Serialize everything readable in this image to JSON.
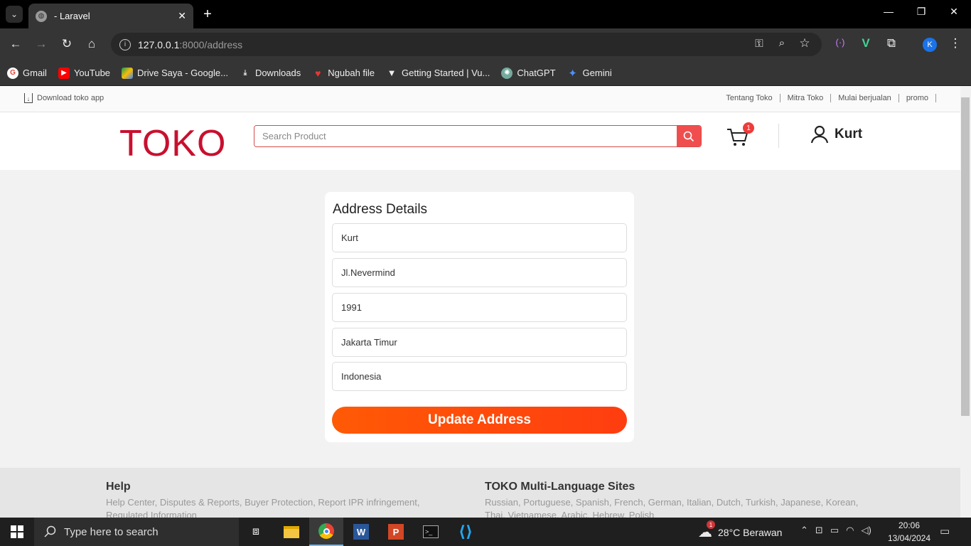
{
  "browser": {
    "tab_title": "- Laravel",
    "url_host": "127.0.0.1",
    "url_path": ":8000/address",
    "profile_initial": "K",
    "bookmarks": [
      "Gmail",
      "YouTube",
      "Drive Saya - Google...",
      "Downloads",
      "Ngubah file",
      "Getting Started | Vu...",
      "ChatGPT",
      "Gemini"
    ]
  },
  "topbar": {
    "download_app": "Download toko app",
    "links": [
      "Tentang Toko",
      "Mitra Toko",
      "Mulai berjualan",
      "promo"
    ]
  },
  "header": {
    "logo": "TOKO",
    "search_placeholder": "Search Product",
    "cart_count": "1",
    "username": "Kurt"
  },
  "address_form": {
    "title": "Address Details",
    "fields": [
      "Kurt",
      "Jl.Nevermind",
      "1991",
      "Jakarta Timur",
      "Indonesia"
    ],
    "submit_label": "Update Address"
  },
  "footer": {
    "help_title": "Help",
    "help_text": "Help Center, Disputes & Reports, Buyer Protection, Report IPR infringement, Regulated Information",
    "sites_title": "TOKO Multi-Language Sites",
    "sites_text": "Russian, Portuguese, Spanish, French, German, Italian, Dutch, Turkish, Japanese, Korean, Thai, Vietnamese, Arabic, Hebrew, Polish"
  },
  "taskbar": {
    "search_placeholder": "Type here to search",
    "weather": "28°C  Berawan",
    "weather_badge": "1",
    "time": "20:06",
    "date": "13/04/2024"
  }
}
